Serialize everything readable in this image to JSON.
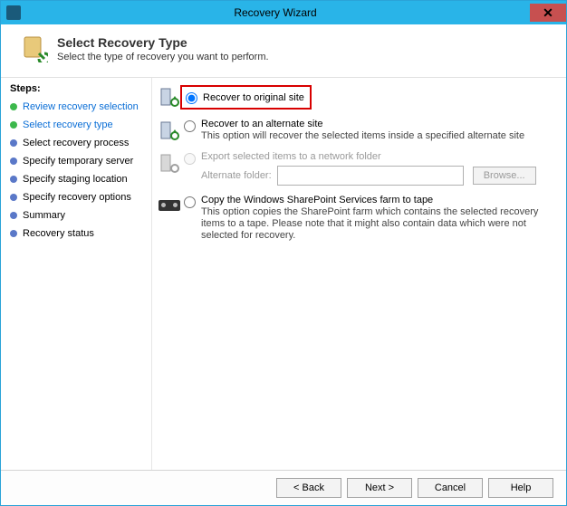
{
  "window": {
    "title": "Recovery Wizard"
  },
  "header": {
    "title": "Select Recovery Type",
    "subtitle": "Select the type of recovery you want to perform."
  },
  "sidebar": {
    "steps_label": "Steps:",
    "items": [
      {
        "label": "Review recovery selection",
        "state": "done"
      },
      {
        "label": "Select recovery type",
        "state": "done"
      },
      {
        "label": "Select recovery process",
        "state": "todo"
      },
      {
        "label": "Specify temporary server",
        "state": "todo"
      },
      {
        "label": "Specify staging location",
        "state": "todo"
      },
      {
        "label": "Specify recovery options",
        "state": "todo"
      },
      {
        "label": "Summary",
        "state": "todo"
      },
      {
        "label": "Recovery status",
        "state": "todo"
      }
    ]
  },
  "options": {
    "original": {
      "label": "Recover to original site"
    },
    "alternate": {
      "label": "Recover to an alternate site",
      "desc": "This option will recover the selected items inside a specified alternate site"
    },
    "network": {
      "label": "Export selected items to a network folder",
      "alt_folder_label": "Alternate folder:",
      "alt_folder_value": "",
      "browse": "Browse..."
    },
    "tape": {
      "label": "Copy the Windows SharePoint Services farm to tape",
      "desc": "This option copies the SharePoint farm which contains the selected recovery items to a tape. Please note that it might also contain data which were not selected for recovery."
    }
  },
  "footer": {
    "back": "< Back",
    "next": "Next >",
    "cancel": "Cancel",
    "help": "Help"
  }
}
